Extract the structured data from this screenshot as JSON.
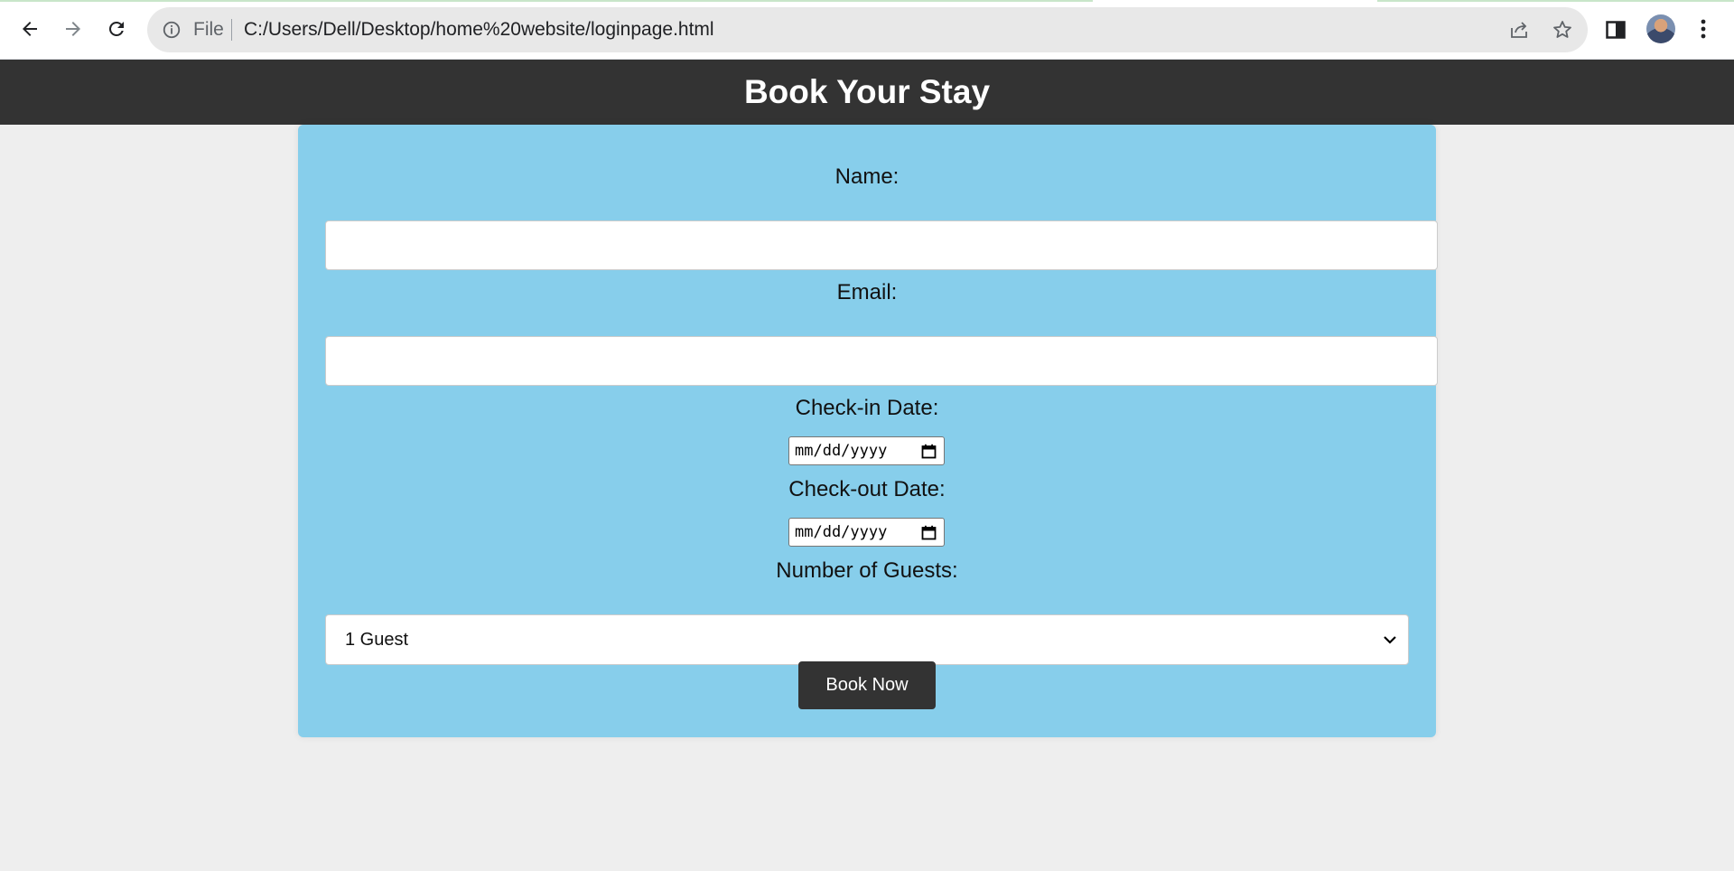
{
  "browser": {
    "scheme_label": "File",
    "url": "C:/Users/Dell/Desktop/home%20website/loginpage.html",
    "icons": [
      "back-arrow-icon",
      "forward-arrow-icon",
      "reload-icon",
      "info-icon",
      "share-icon",
      "star-icon",
      "side-panel-icon",
      "avatar",
      "kebab-menu-icon"
    ]
  },
  "page": {
    "title": "Book Your Stay",
    "colors": {
      "header_bg": "#333333",
      "card_bg": "#87ceeb",
      "page_bg": "#eeeeee",
      "button_bg": "#333333"
    }
  },
  "form": {
    "name_label": "Name:",
    "name_value": "",
    "email_label": "Email:",
    "email_value": "",
    "checkin_label": "Check-in Date:",
    "checkin_value": "mm/dd/yyyy",
    "checkout_label": "Check-out Date:",
    "checkout_value": "mm/dd/yyyy",
    "guests_label": "Number of Guests:",
    "guests_selected": "1 Guest",
    "submit_label": "Book Now"
  }
}
